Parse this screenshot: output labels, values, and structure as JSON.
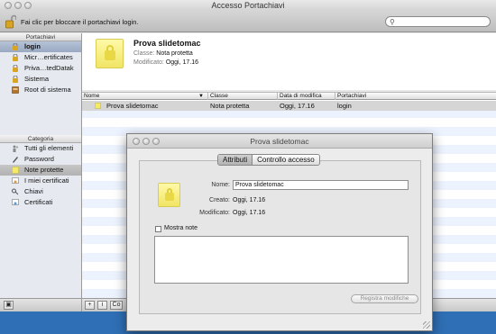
{
  "window": {
    "title": "Accesso Portachiavi"
  },
  "toolbar": {
    "lock_text": "Fai clic per bloccare il portachiavi login.",
    "search_placeholder": ""
  },
  "sidebar": {
    "keychains_header": "Portachiavi",
    "keychains": [
      {
        "label": "login",
        "icon": "keychain-lock-icon",
        "selected": true
      },
      {
        "label": "Micr…ertificates",
        "icon": "lock-icon"
      },
      {
        "label": "Priva…tedDatak",
        "icon": "lock-icon"
      },
      {
        "label": "Sistema",
        "icon": "lock-icon"
      },
      {
        "label": "Root di sistema",
        "icon": "cabinet-icon"
      }
    ],
    "category_header": "Categoria",
    "categories": [
      {
        "label": "Tutti gli elementi",
        "icon": "people-icon"
      },
      {
        "label": "Password",
        "icon": "pen-icon"
      },
      {
        "label": "Note protette",
        "icon": "note-icon",
        "selected": true
      },
      {
        "label": "I miei certificati",
        "icon": "certificate-icon"
      },
      {
        "label": "Chiavi",
        "icon": "key-icon"
      },
      {
        "label": "Certificati",
        "icon": "certificate-icon"
      }
    ],
    "bottom_buttons": [
      "▣",
      "+",
      "i",
      "Co"
    ]
  },
  "detail": {
    "title": "Prova slidetomac",
    "class_label": "Classe:",
    "class_value": "Nota protetta",
    "modified_label": "Modificato:",
    "modified_value": "Oggi, 17.16"
  },
  "table": {
    "columns": [
      "Nome",
      "Classe",
      "Data di modifica",
      "Portachiavi"
    ],
    "rows": [
      {
        "name": "Prova slidetomac",
        "class": "Nota protetta",
        "date": "Oggi, 17.16",
        "keychain": "login"
      }
    ]
  },
  "dialog": {
    "title": "Prova slidetomac",
    "tabs": [
      "Attributi",
      "Controllo accesso"
    ],
    "name_label": "Nome:",
    "name_value": "Prova slidetomac",
    "created_label": "Creato:",
    "created_value": "Oggi, 17.16",
    "modified_label": "Modificato:",
    "modified_value": "Oggi, 17.16",
    "show_notes_label": "Mostra note",
    "save_button": "Registra modifiche"
  },
  "colors": {
    "selection": "#d5d5d5",
    "note_yellow": "#f1e565",
    "desktop": "#2f6fb5"
  }
}
